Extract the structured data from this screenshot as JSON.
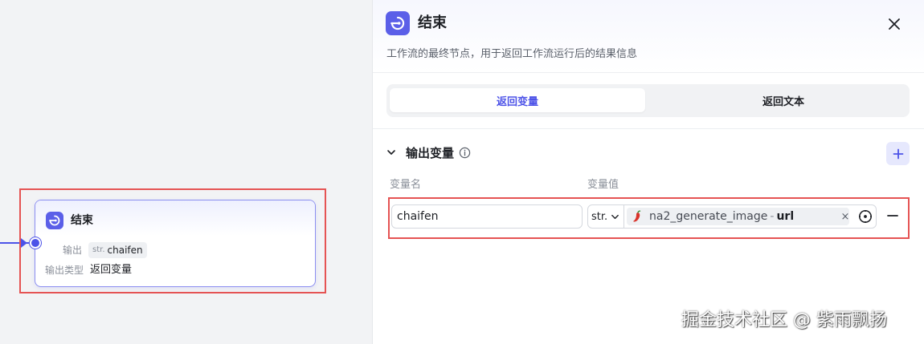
{
  "node": {
    "title": "结束",
    "output_key": "输出",
    "output_type": "str.",
    "output_name": "chaifen",
    "mode_key": "输出类型",
    "mode_value": "返回变量"
  },
  "panel": {
    "title": "结束",
    "description": "工作流的最终节点，用于返回工作流运行后的结果信息",
    "tabs": [
      {
        "label": "返回变量",
        "active": true
      },
      {
        "label": "返回文本",
        "active": false
      }
    ],
    "section": {
      "title": "输出变量",
      "columns": [
        "变量名",
        "变量值"
      ],
      "rows": [
        {
          "name": "chaifen",
          "type": "str.",
          "ref_node": "na2_generate_image",
          "ref_sep": "-",
          "ref_var": "url",
          "clear": "×"
        }
      ]
    }
  },
  "watermark": "掘金技术社区 @ 紫雨飘扬",
  "colors": {
    "accent": "#4d53e8",
    "highlight": "#e55353",
    "icon_bg": "#5b5fe8"
  },
  "icons": [
    "end-node-icon",
    "close-icon",
    "chevron-down-icon",
    "info-icon",
    "plus-icon",
    "chili-pepper-icon",
    "target-icon",
    "minus-icon"
  ]
}
